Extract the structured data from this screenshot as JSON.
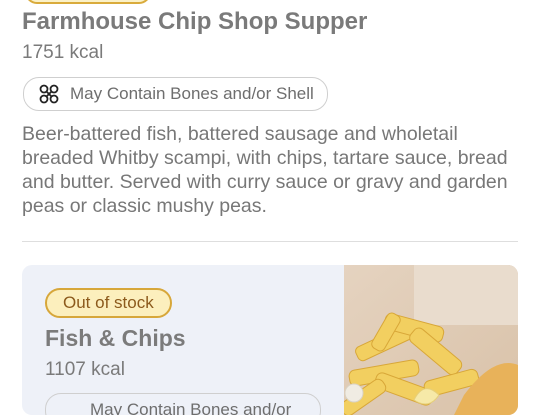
{
  "item1": {
    "title": "Farmhouse Chip Shop Supper",
    "kcal": "1751 kcal",
    "allergen": "May Contain Bones and/or Shell",
    "description": "Beer-battered fish, battered sausage and wholetail breaded Whitby scampi, with chips, tartare sauce, bread and butter. Served with curry sauce or gravy and garden peas or classic mushy peas.",
    "allergen_icon": "bone-shell-icon"
  },
  "item2": {
    "status": "Out of stock",
    "title": "Fish & Chips",
    "kcal": "1107 kcal",
    "allergen": "May Contain Bones and/or",
    "image": "fish-and-chips-photo"
  },
  "colors": {
    "badge_fill": "#fcefbd",
    "badge_border": "#d7a73a",
    "card_bg": "#eef1f8"
  }
}
